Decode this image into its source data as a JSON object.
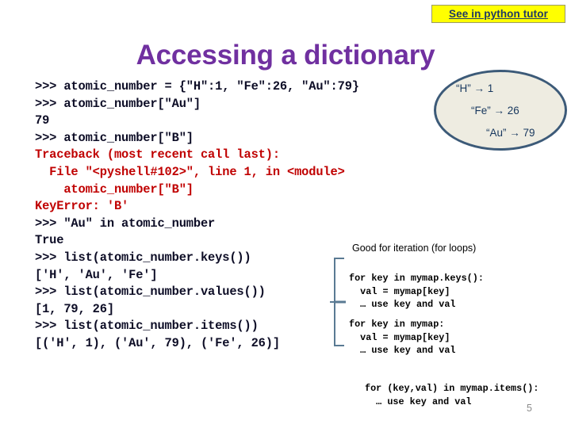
{
  "link": {
    "label": "See in python tutor",
    "bg_color": "#ffff00",
    "text_color": "#1f3864"
  },
  "title": {
    "text": "Accessing a dictionary",
    "color": "#7030a0"
  },
  "console": {
    "lines": [
      {
        "text": "&gt;&gt;&gt; atomic_number = {\"H\":1, \"Fe\":26, \"Au\":79}",
        "style": "normal"
      },
      {
        "text": "&gt;&gt;&gt; atomic_number[\"Au\"]",
        "style": "normal"
      },
      {
        "text": "79",
        "style": "normal"
      },
      {
        "text": "&gt;&gt;&gt; atomic_number[\"B\"]",
        "style": "normal"
      },
      {
        "text": "Traceback (most recent call last):",
        "style": "error"
      },
      {
        "text": "  File \"&lt;pyshell#102&gt;\", line 1, in &lt;module&gt;",
        "style": "error"
      },
      {
        "text": "    atomic_number[\"B\"]",
        "style": "error"
      },
      {
        "text": "KeyError: 'B'",
        "style": "error"
      },
      {
        "text": "&gt;&gt;&gt; \"Au\" in atomic_number",
        "style": "normal"
      },
      {
        "text": "True",
        "style": "normal"
      },
      {
        "text": "&gt;&gt;&gt; list(atomic_number.keys())",
        "style": "normal"
      },
      {
        "text": "['H', 'Au', 'Fe']",
        "style": "normal"
      },
      {
        "text": "&gt;&gt;&gt; list(atomic_number.values())",
        "style": "normal"
      },
      {
        "text": "[1, 79, 26]",
        "style": "normal"
      },
      {
        "text": "&gt;&gt;&gt; list(atomic_number.items())",
        "style": "normal"
      },
      {
        "text": "[('H', 1), ('Au', 79), ('Fe', 26)]",
        "style": "normal"
      }
    ],
    "text_color": "#0d0d26",
    "error_color": "#c00000"
  },
  "oval_callout": {
    "fill_color": "#eeece1",
    "border_color": "#3c5a78",
    "text_color": "#17375e",
    "mappings": [
      "“H” → 1",
      "“Fe” → 26",
      "“Au” → 79"
    ]
  },
  "annotations": {
    "heading": "Good for iteration (for loops)",
    "snippets": [
      "for key in mymap.keys():\n  val = mymap[key]\n  … use key and val",
      "for key in mymap:\n  val = mymap[key]\n  … use key and val",
      "for (key,val) in mymap.items():\n  … use key and val"
    ]
  },
  "footer": {
    "page_number": "5",
    "page_number_color": "#8a8a8a"
  }
}
